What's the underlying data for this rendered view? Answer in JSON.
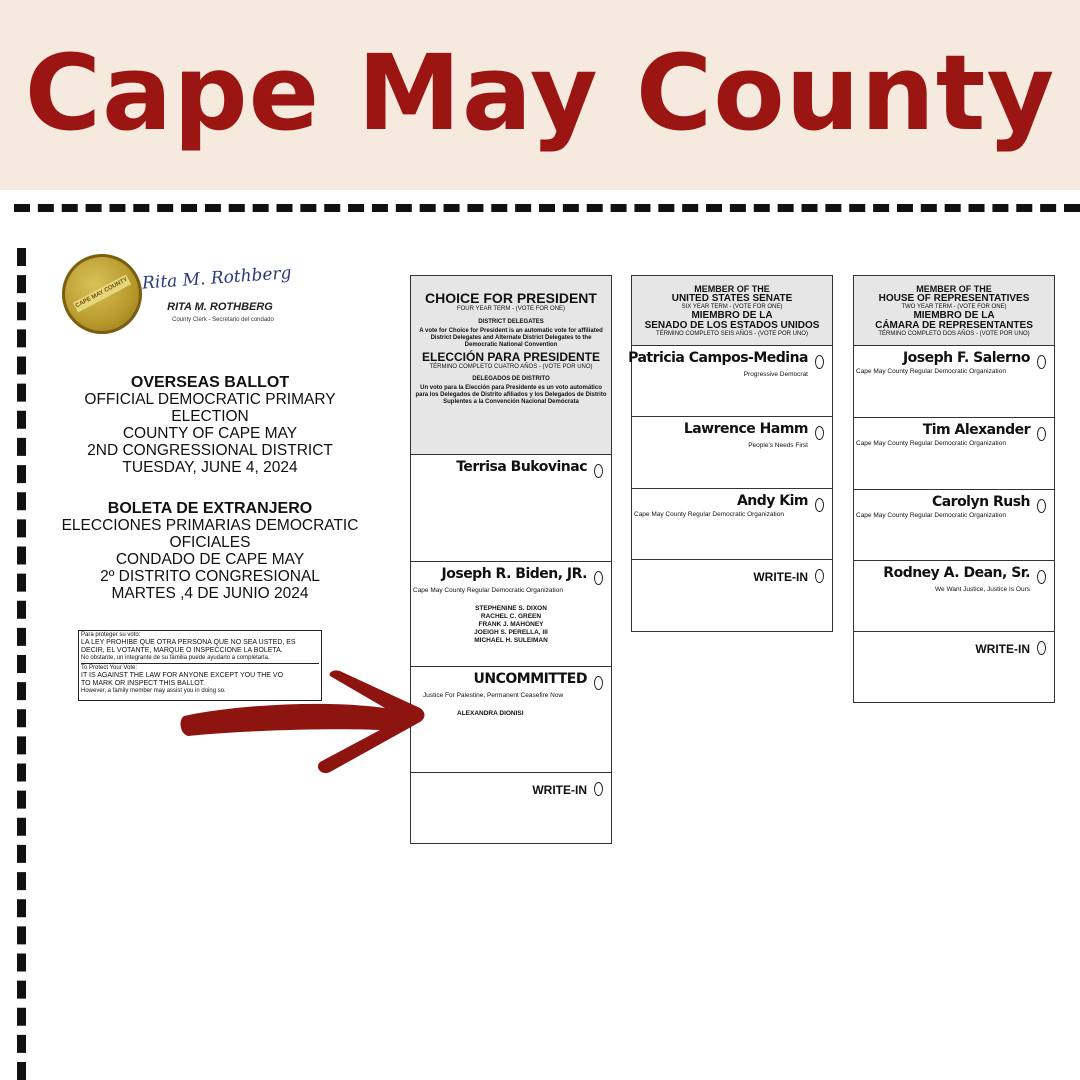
{
  "banner": {
    "title": "Cape May County"
  },
  "clerk": {
    "seal_text": "CAPE MAY COUNTY",
    "signature": "Rita M. Rothberg",
    "name": "RITA M. ROTHBERG",
    "title": "County Clerk - Secretario del condado"
  },
  "ballot_english": {
    "line1": "OVERSEAS BALLOT",
    "line2": "OFFICIAL DEMOCRATIC PRIMARY",
    "line3": "ELECTION",
    "line4": "COUNTY OF CAPE MAY",
    "line5": "2ND CONGRESSIONAL DISTRICT",
    "line6": "TUESDAY, JUNE 4, 2024"
  },
  "ballot_spanish": {
    "line1": "BOLETA DE EXTRANJERO",
    "line2": "ELECCIONES PRIMARIAS DEMOCRATIC",
    "line3": "OFICIALES",
    "line4": "CONDADO DE CAPE MAY",
    "line5": "2º DISTRITO CONGRESIONAL",
    "line6": "MARTES ,4 DE JUNIO 2024"
  },
  "notice": {
    "es_heading": "Para proteger su voto:",
    "es_line1": "LA LEY PROHIBE QUE OTRA PERSONA QUE NO SEA USTED, ES",
    "es_line2": "DECIR, EL VOTANTE, MARQUE O INSPECCIONE LA BOLETA.",
    "es_line3": "No obstante, un integrante de su familia puede ayudarlo a completarla.",
    "en_heading": "To Protect Your Vote:",
    "en_line1": "IT IS AGAINST THE LAW FOR ANYONE EXCEPT YOU THE VO",
    "en_line2": "TO MARK OR INSPECT THIS BALLOT.",
    "en_line3": "However, a family member may assist you in doing so."
  },
  "president": {
    "title": "CHOICE FOR PRESIDENT",
    "term": "FOUR YEAR TERM - (VOTE FOR ONE)",
    "delegates": "DISTRICT DELEGATES",
    "note": "A vote for Choice for President is an automatic vote for affiliated District Delegates and Alternate District Delegates to the Democratic National Convention",
    "title_es": "ELECCIÓN PARA PRESIDENTE",
    "term_es": "TÉRMINO COMPLETO CUATRO AÑOS - (VOTE POR UNO)",
    "delegates_es": "DELEGADOS DE DISTRITO",
    "note_es": "Un voto para la Elección para Presidente es un voto automático para los Delegados de Distrito afiliados y los Delegados de Distrito Suplentes a la Convención Nacional Demócrata",
    "candidates": [
      {
        "name": "Terrisa Bukovinac",
        "party": "",
        "delegates": []
      },
      {
        "name": "Joseph R. Biden, JR.",
        "party": "Cape May County Regular Democratic Organization",
        "delegates": [
          "STEPHENINE S. DIXON",
          "RACHEL C. GREEN",
          "FRANK J. MAHONEY",
          "JOEIGH S. PERELLA, III",
          "MICHAEL H. SULEIMAN"
        ]
      },
      {
        "name": "UNCOMMITTED",
        "party": "Justice For Palestine, Permanent Ceasefire Now",
        "delegates": [
          "ALEXANDRA DIONISI"
        ]
      }
    ],
    "writein": "WRITE-IN"
  },
  "senate": {
    "h1": "MEMBER OF THE",
    "h2": "UNITED STATES SENATE",
    "term": "SIX YEAR TERM - (VOTE FOR ONE)",
    "h1_es": "MIEMBRO DE LA",
    "h2_es": "SENADO DE LOS ESTADOS UNIDOS",
    "term_es": "TÉRMINO COMPLETO SEIS AÑOS - (VOTE POR UNO)",
    "candidates": [
      {
        "name": "Patricia Campos-Medina",
        "party": "Progressive Democrat"
      },
      {
        "name": "Lawrence Hamm",
        "party": "People's Needs First"
      },
      {
        "name": "Andy Kim",
        "party": "Cape May County Regular Democratic Organization"
      }
    ],
    "writein": "WRITE-IN"
  },
  "house": {
    "h1": "MEMBER OF THE",
    "h2": "HOUSE OF REPRESENTATIVES",
    "term": "TWO YEAR TERM - (VOTE FOR ONE)",
    "h1_es": "MIEMBRO DE LA",
    "h2_es": "CÁMARA DE REPRESENTANTES",
    "term_es": "TÉRMINO COMPLETO DOS AÑOS - (VOTE POR UNO)",
    "candidates": [
      {
        "name": "Joseph F. Salerno",
        "party": "Cape May County Regular Democratic Organization"
      },
      {
        "name": "Tim Alexander",
        "party": "Cape May County Regular Democratic Organization"
      },
      {
        "name": "Carolyn Rush",
        "party": "Cape May County Regular Democratic Organization"
      },
      {
        "name": "Rodney A. Dean, Sr.",
        "party": "We Want Justice, Justice Is Ours"
      }
    ],
    "writein": "WRITE-IN"
  },
  "colors": {
    "banner_bg": "#f6e9dd",
    "brand_red": "#9b1512",
    "header_gray": "#e6e6e6"
  }
}
